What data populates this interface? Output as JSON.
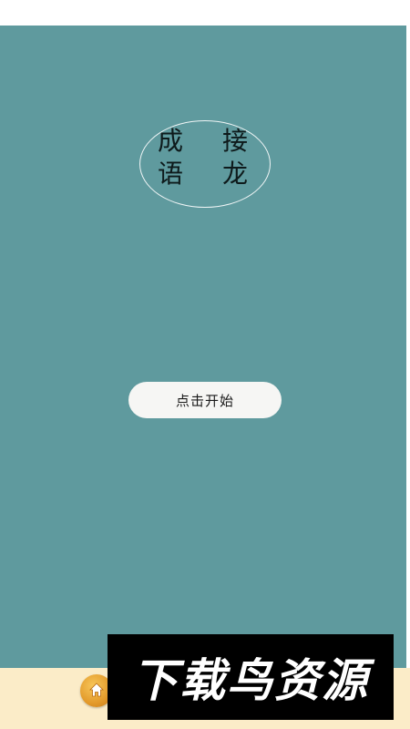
{
  "title": {
    "chars": [
      "成",
      "接",
      "语",
      "龙"
    ]
  },
  "start_button": {
    "label": "点击开始"
  },
  "colors": {
    "background": "#5f9a9e",
    "button": "#f6f6f4",
    "bottom_bar": "#fbecc8",
    "home_button": "#e39a2a"
  },
  "bottom_bar": {
    "home_icon": "home-icon"
  },
  "watermark": {
    "text": "下载鸟资源"
  }
}
